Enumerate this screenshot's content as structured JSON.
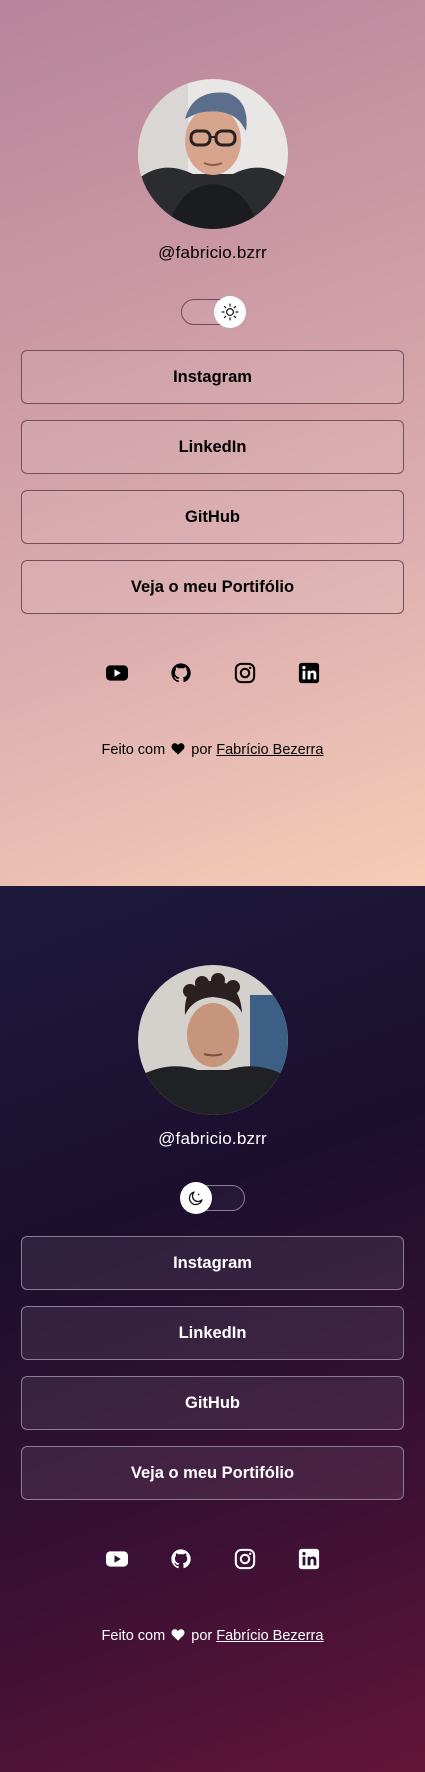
{
  "profile": {
    "handle": "@fabricio.bzrr"
  },
  "links": [
    {
      "label": "Instagram"
    },
    {
      "label": "LinkedIn"
    },
    {
      "label": "GitHub"
    },
    {
      "label": "Veja o meu Portifólio"
    }
  ],
  "socials": [
    "youtube-icon",
    "github-icon",
    "instagram-icon",
    "linkedin-icon"
  ],
  "footer": {
    "prefix": "Feito com",
    "middle": "por",
    "author": "Fabrício Bezerra"
  },
  "themes": {
    "light": {
      "toggle_icon": "sun-icon"
    },
    "dark": {
      "toggle_icon": "moon-icon"
    }
  }
}
